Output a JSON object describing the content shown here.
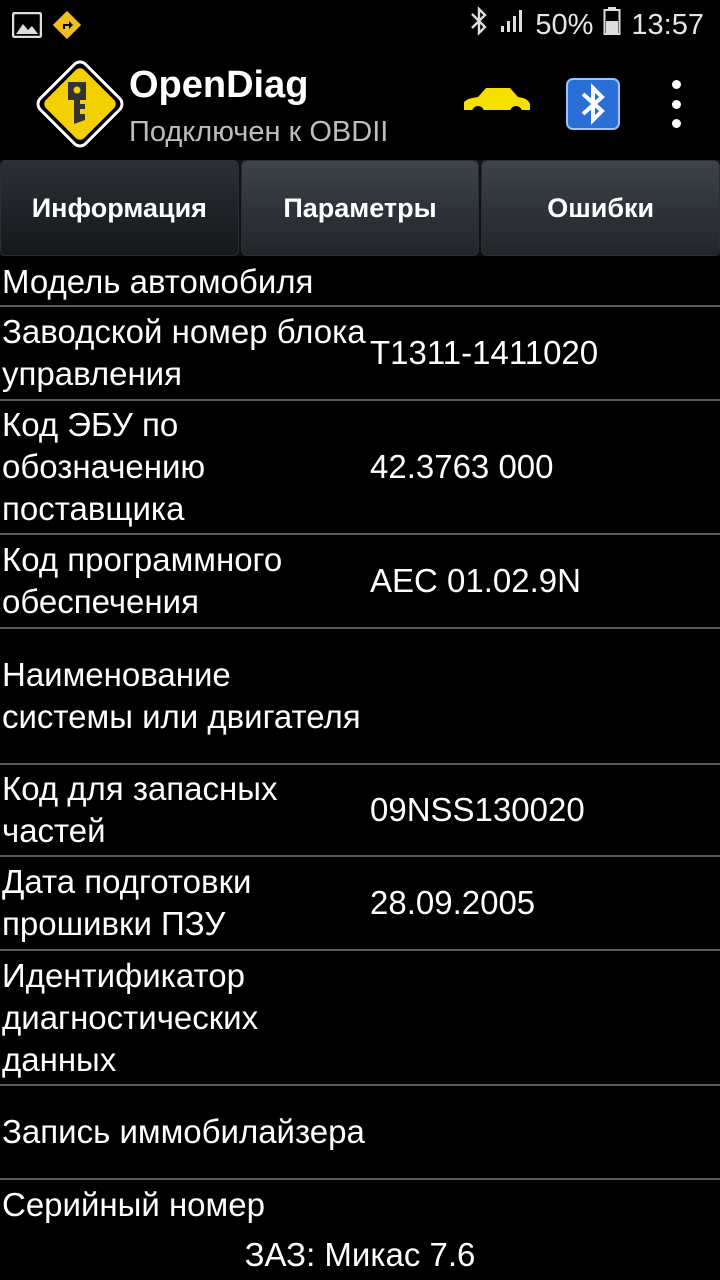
{
  "status_bar": {
    "battery_percent": "50%",
    "time": "13:57",
    "icons": [
      "image-notification-icon",
      "navigation-icon",
      "bluetooth-icon",
      "signal-icon",
      "battery-icon"
    ]
  },
  "app": {
    "title": "OpenDiag",
    "subtitle": "Подключен к OBDII"
  },
  "tabs": [
    {
      "label": "Информация",
      "active": true
    },
    {
      "label": "Параметры",
      "active": false
    },
    {
      "label": "Ошибки",
      "active": false
    }
  ],
  "rows": [
    {
      "label": "Модель автомобиля",
      "value": ""
    },
    {
      "label": "Заводской номер блока управления",
      "value": "T1311-1411020"
    },
    {
      "label": "Код ЭБУ по обозначению поставщика",
      "value": "42.3763 000"
    },
    {
      "label": "Код программного обеспечения",
      "value": "AEC 01.02.9N"
    },
    {
      "label": "Наименование системы или двигателя",
      "value": ""
    },
    {
      "label": "Код для запасных частей",
      "value": "09NSS130020"
    },
    {
      "label": "Дата подготовки прошивки ПЗУ",
      "value": "28.09.2005"
    },
    {
      "label": "Идентификатор диагностических данных",
      "value": ""
    },
    {
      "label": "Запись иммобилайзера",
      "value": ""
    },
    {
      "label": "Серийный номер",
      "value": ""
    }
  ],
  "footer": "ЗАЗ: Микас 7.6",
  "colors": {
    "background": "#000000",
    "logo_yellow": "#f5d000",
    "car_yellow": "#f5e000",
    "bt_blue": "#2a6fd6"
  }
}
